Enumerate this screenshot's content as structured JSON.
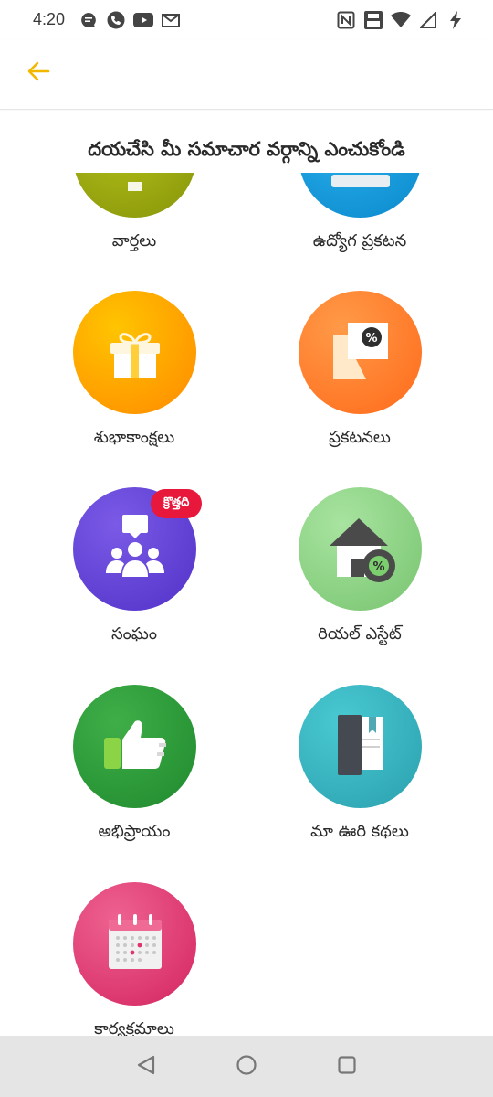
{
  "status_bar": {
    "time": "4:20",
    "left_icons": [
      "chat-bubble-icon",
      "phone-icon",
      "youtube-icon",
      "gmail-icon"
    ],
    "right_icons": [
      "nfc-icon",
      "volte-icon",
      "wifi-icon",
      "signal-icon",
      "battery-charging-icon"
    ]
  },
  "header": {
    "back_icon": "arrow-left-icon",
    "accent_color": "#f2b800"
  },
  "page": {
    "title": "దయచేసి మీ సమాచార వర్గాన్ని ఎంచుకోండి"
  },
  "categories": [
    {
      "label": "వార్తలు",
      "icon": "news-icon"
    },
    {
      "label": "ఉద్యోగ ప్రకటన",
      "icon": "job-icon"
    },
    {
      "label": "శుభాకాంక్షలు",
      "icon": "gift-icon"
    },
    {
      "label": "ప్రకటనలు",
      "icon": "discount-tag-icon"
    },
    {
      "label": "సంఘం",
      "icon": "community-icon",
      "badge": "క్రొత్తది"
    },
    {
      "label": "రియల్ ఎస్టేట్",
      "icon": "house-discount-icon"
    },
    {
      "label": "అభిప్రాయం",
      "icon": "thumbs-up-icon"
    },
    {
      "label": "మా ఊరి కథలు",
      "icon": "book-icon"
    },
    {
      "label": "కార్యక్రమాలు",
      "icon": "calendar-icon"
    }
  ],
  "nav_bar": {
    "buttons": [
      "back-triangle-icon",
      "home-circle-icon",
      "recents-square-icon"
    ]
  }
}
